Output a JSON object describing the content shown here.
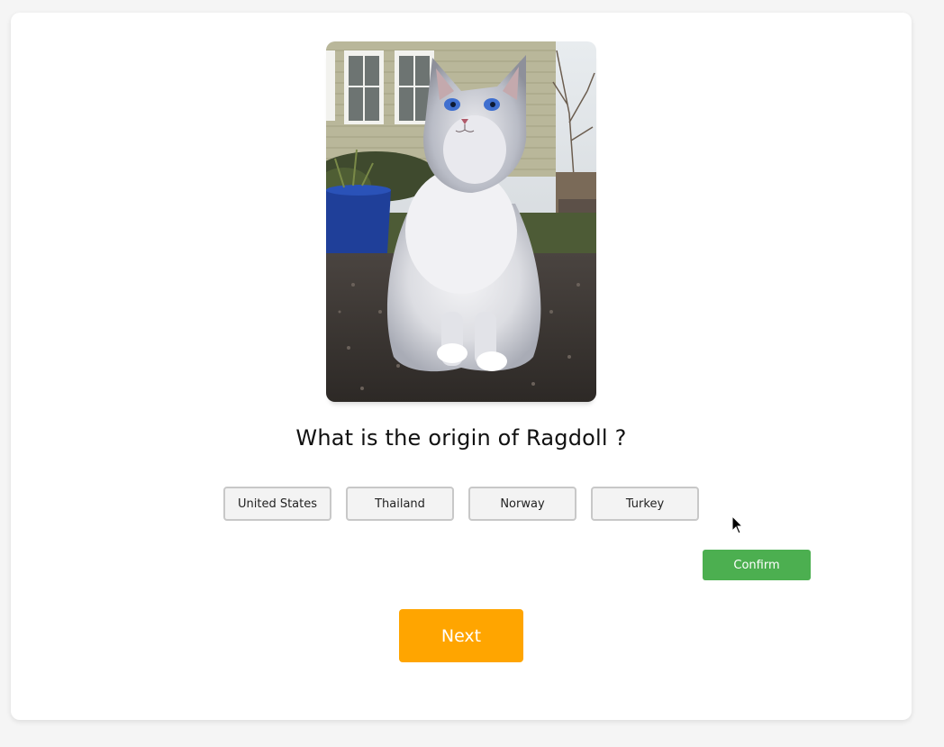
{
  "quiz": {
    "image_alt": "Ragdoll cat",
    "question": "What is the origin of Ragdoll ?",
    "options": [
      {
        "label": "United States"
      },
      {
        "label": "Thailand"
      },
      {
        "label": "Norway"
      },
      {
        "label": "Turkey"
      }
    ],
    "confirm_label": "Confirm",
    "next_label": "Next"
  },
  "colors": {
    "confirm": "#4caf50",
    "next": "#ffa500",
    "page_background": "#f5f5f5",
    "card": "#ffffff"
  }
}
